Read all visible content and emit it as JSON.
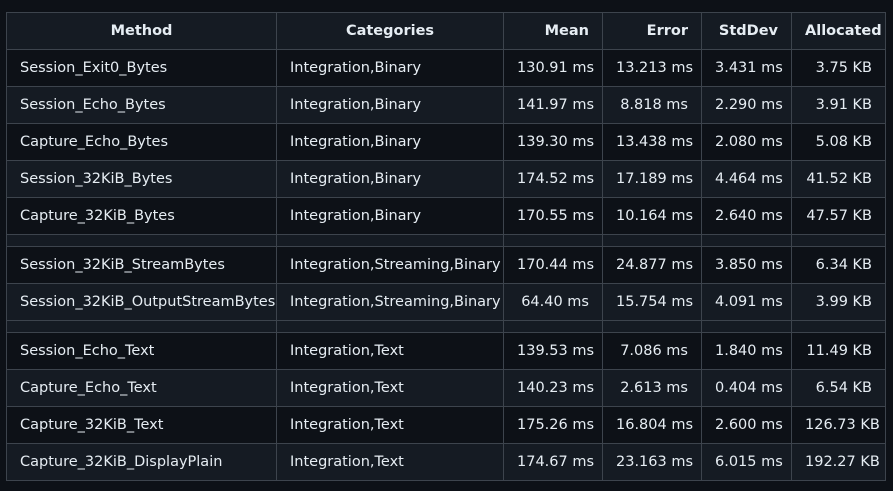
{
  "headers": [
    "Method",
    "Categories",
    "Mean",
    "Error",
    "StdDev",
    "Allocated"
  ],
  "rows": [
    {
      "method": "Session_Exit0_Bytes",
      "categories": "Integration,Binary",
      "mean": "130.91 ms",
      "error": "13.213 ms",
      "stddev": "3.431 ms",
      "allocated": "3.75 KB"
    },
    {
      "method": "Session_Echo_Bytes",
      "categories": "Integration,Binary",
      "mean": "141.97 ms",
      "error": "8.818 ms",
      "stddev": "2.290 ms",
      "allocated": "3.91 KB"
    },
    {
      "method": "Capture_Echo_Bytes",
      "categories": "Integration,Binary",
      "mean": "139.30 ms",
      "error": "13.438 ms",
      "stddev": "2.080 ms",
      "allocated": "5.08 KB"
    },
    {
      "method": "Session_32KiB_Bytes",
      "categories": "Integration,Binary",
      "mean": "174.52 ms",
      "error": "17.189 ms",
      "stddev": "4.464 ms",
      "allocated": "41.52 KB"
    },
    {
      "method": "Capture_32KiB_Bytes",
      "categories": "Integration,Binary",
      "mean": "170.55 ms",
      "error": "10.164 ms",
      "stddev": "2.640 ms",
      "allocated": "47.57 KB"
    },
    {
      "method": "Session_32KiB_StreamBytes",
      "categories": "Integration,Streaming,Binary",
      "mean": "170.44 ms",
      "error": "24.877 ms",
      "stddev": "3.850 ms",
      "allocated": "6.34 KB"
    },
    {
      "method": "Session_32KiB_OutputStreamBytes",
      "categories": "Integration,Streaming,Binary",
      "mean": "64.40 ms",
      "error": "15.754 ms",
      "stddev": "4.091 ms",
      "allocated": "3.99 KB"
    },
    {
      "method": "Session_Echo_Text",
      "categories": "Integration,Text",
      "mean": "139.53 ms",
      "error": "7.086 ms",
      "stddev": "1.840 ms",
      "allocated": "11.49 KB"
    },
    {
      "method": "Capture_Echo_Text",
      "categories": "Integration,Text",
      "mean": "140.23 ms",
      "error": "2.613 ms",
      "stddev": "0.404 ms",
      "allocated": "6.54 KB"
    },
    {
      "method": "Capture_32KiB_Text",
      "categories": "Integration,Text",
      "mean": "175.26 ms",
      "error": "16.804 ms",
      "stddev": "2.600 ms",
      "allocated": "126.73 KB"
    },
    {
      "method": "Capture_32KiB_DisplayPlain",
      "categories": "Integration,Text",
      "mean": "174.67 ms",
      "error": "23.163 ms",
      "stddev": "6.015 ms",
      "allocated": "192.27 KB"
    }
  ]
}
